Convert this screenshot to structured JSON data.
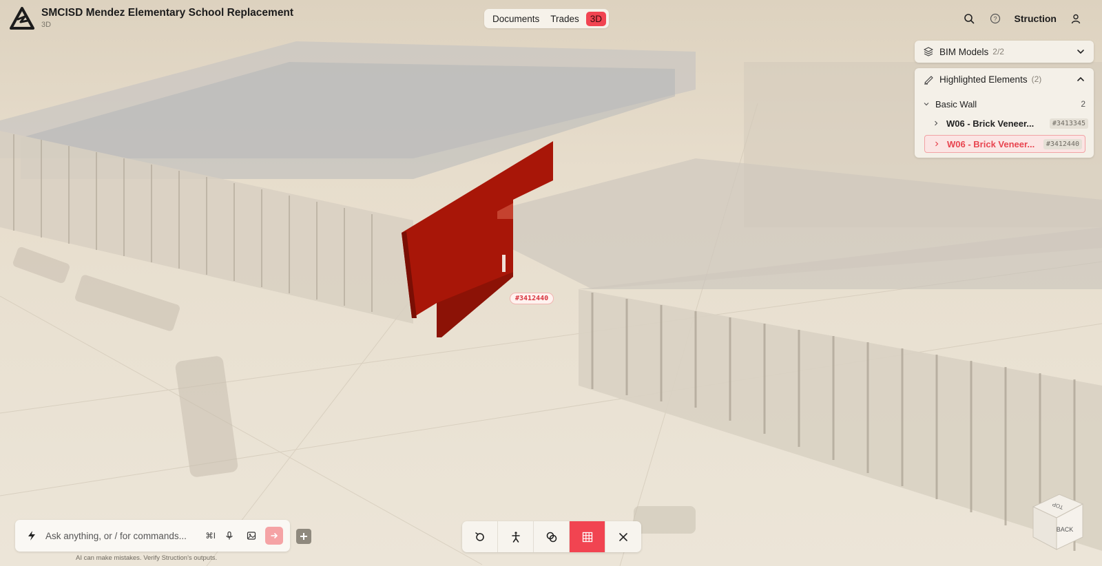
{
  "header": {
    "project_title": "SMCISD Mendez Elementary School Replacement",
    "project_subtitle": "3D",
    "tabs": [
      {
        "label": "Documents",
        "active": false
      },
      {
        "label": "Trades",
        "active": false
      },
      {
        "label": "3D",
        "active": true
      }
    ],
    "user_label": "Struction",
    "icons": [
      "search-icon",
      "help-icon",
      "user-icon"
    ]
  },
  "panels": {
    "bim_models": {
      "title": "BIM Models",
      "count": "2/2",
      "expanded": false
    },
    "highlighted_elements": {
      "title": "Highlighted Elements",
      "count": "(2)",
      "expanded": true,
      "group": {
        "name": "Basic Wall",
        "count": "2"
      },
      "items": [
        {
          "name": "W06 - Brick Veneer...",
          "id": "#3413345",
          "selected": false
        },
        {
          "name": "W06 - Brick Veneer...",
          "id": "#3412440",
          "selected": true
        }
      ]
    }
  },
  "viewport": {
    "element_tag": "#3412440",
    "highlight_color": "#b01a0c",
    "view_cube": {
      "top_label": "TOP",
      "front_label": "BACK"
    }
  },
  "chat": {
    "placeholder": "Ask anything, or / for commands...",
    "shortcut": "⌘I",
    "disclaimer": "AI can make mistakes. Verify Struction's outputs."
  },
  "toolbar": {
    "buttons": [
      {
        "icon": "reset-view-icon",
        "active": false
      },
      {
        "icon": "walk-mode-icon",
        "active": false
      },
      {
        "icon": "isolate-icon",
        "active": false
      },
      {
        "icon": "grid-icon",
        "active": true
      },
      {
        "icon": "close-icon",
        "active": false
      }
    ]
  },
  "colors": {
    "accent": "#f14451",
    "panel_bg": "#f4f0e8",
    "scene_bg": "#e6dccb"
  }
}
